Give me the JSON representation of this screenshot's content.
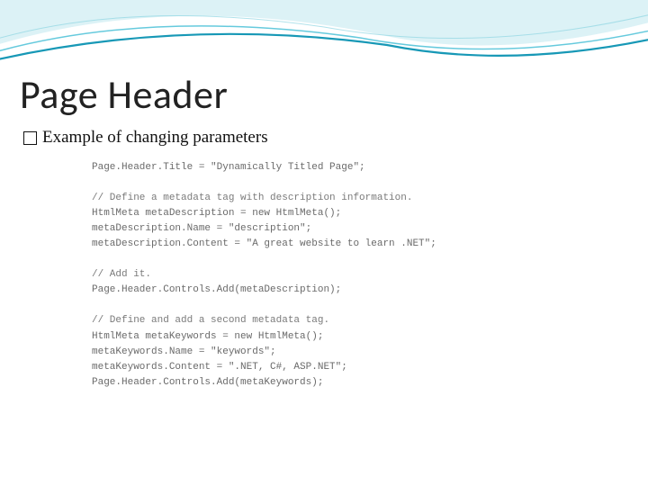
{
  "slide": {
    "title": "Page Header",
    "bullet": "Example of changing parameters"
  },
  "code": {
    "l01": "Page.Header.Title = \"Dynamically Titled Page\";",
    "l02": "",
    "l03": "// Define a metadata tag with description information.",
    "l04": "HtmlMeta metaDescription = new HtmlMeta();",
    "l05": "metaDescription.Name = \"description\";",
    "l06": "metaDescription.Content = \"A great website to learn .NET\";",
    "l07": "",
    "l08": "// Add it.",
    "l09": "Page.Header.Controls.Add(metaDescription);",
    "l10": "",
    "l11": "// Define and add a second metadata tag.",
    "l12": "HtmlMeta metaKeywords = new HtmlMeta();",
    "l13": "metaKeywords.Name = \"keywords\";",
    "l14": "metaKeywords.Content = \".NET, C#, ASP.NET\";",
    "l15": "Page.Header.Controls.Add(metaKeywords);"
  }
}
